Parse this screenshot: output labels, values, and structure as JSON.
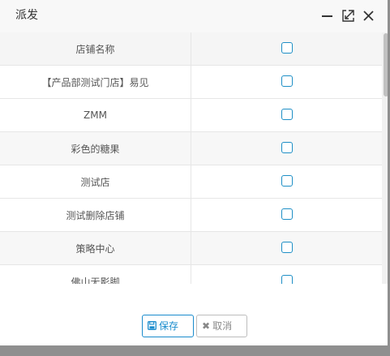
{
  "dialog": {
    "title": "派发"
  },
  "titlebar": {
    "minimize_icon": "minimize-icon",
    "maximize_icon": "maximize-icon",
    "close_icon": "close-icon"
  },
  "table": {
    "header": "店铺名称",
    "rows": [
      {
        "name": "【产品部测试门店】易见",
        "checked": false
      },
      {
        "name": "ZMM",
        "checked": false
      },
      {
        "name": "彩色的糖果",
        "checked": false
      },
      {
        "name": "测试店",
        "checked": false
      },
      {
        "name": "测试删除店铺",
        "checked": false
      },
      {
        "name": "策略中心",
        "checked": false
      },
      {
        "name": "佛山无影脚",
        "checked": false
      }
    ]
  },
  "footer": {
    "save_label": "保存",
    "save_icon": "save-icon",
    "cancel_label": "取消",
    "cancel_icon": "close-x-icon"
  },
  "colors": {
    "accent": "#1a8ccd",
    "checkbox_border": "#1e8fc6",
    "cancel_text": "#888888"
  }
}
